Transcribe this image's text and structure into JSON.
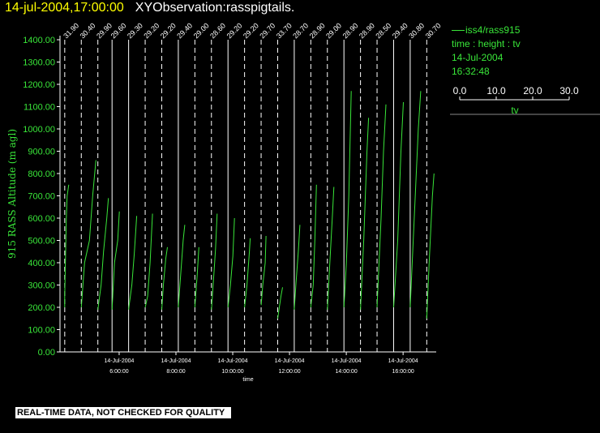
{
  "header": {
    "datetime": "14-jul-2004,17:00:00",
    "title": "XYObservation:rasspigtails."
  },
  "legend": {
    "series": "iss4/rass915",
    "axes": "time : height : tv",
    "date": "14-Jul-2004",
    "time": "16:32:48",
    "scale_ticks": [
      "0.0",
      "10.0",
      "20.0",
      "30.0"
    ],
    "scale_label": "tv"
  },
  "footer": "REAL-TIME DATA, NOT CHECKED FOR QUALITY",
  "colors": {
    "background": "#000000",
    "trace": "#39e639",
    "axis": "#ffffff",
    "title": "#ffff00"
  },
  "chart_data": {
    "type": "line",
    "title": "XYObservation:rasspigtails.",
    "xlabel": "time",
    "ylabel": "915 RASS Altitude (m agl)",
    "ylim": [
      0,
      1400
    ],
    "yticks": [
      "0.00",
      "100.00",
      "200.00",
      "300.00",
      "400.00",
      "500.00",
      "600.00",
      "700.00",
      "800.00",
      "900.00",
      "1000.00",
      "1100.00",
      "1200.00",
      "1300.00",
      "1400.00"
    ],
    "xlim": [
      "04:05",
      "17:00"
    ],
    "xticks": [
      {
        "time": "06:00",
        "date": "14-Jul-2004",
        "label": "6:00:00"
      },
      {
        "time": "08:00",
        "date": "14-Jul-2004",
        "label": "8:00:00"
      },
      {
        "time": "10:00",
        "date": "14-Jul-2004",
        "label": "10:00:00"
      },
      {
        "time": "12:00",
        "date": "14-Jul-2004",
        "label": "12:00:00"
      },
      {
        "time": "14:00",
        "date": "14-Jul-2004",
        "label": "14:00:00"
      },
      {
        "time": "16:00",
        "date": "14-Jul-2004",
        "label": "16:00:00"
      }
    ],
    "grid": "vertical dashed lines at each profile time",
    "profiles": [
      {
        "time": "04:05",
        "label": "31.90",
        "tv": [
          [
            0,
            200
          ],
          [
            0,
            250
          ],
          [
            2,
            600
          ],
          [
            3,
            700
          ],
          [
            5,
            750
          ]
        ]
      },
      {
        "time": "04:40",
        "label": "30.40",
        "tv": [
          [
            0,
            200
          ],
          [
            4,
            400
          ],
          [
            10,
            500
          ],
          [
            14,
            700
          ],
          [
            18,
            860
          ]
        ]
      },
      {
        "time": "05:15",
        "label": "29.90",
        "tv": [
          [
            0,
            190
          ],
          [
            4,
            300
          ],
          [
            7,
            450
          ],
          [
            11,
            600
          ],
          [
            13,
            690
          ]
        ]
      },
      {
        "time": "05:45",
        "label": "29.60",
        "tv": [
          [
            0,
            190
          ],
          [
            3,
            400
          ],
          [
            7,
            500
          ],
          [
            9,
            630
          ]
        ]
      },
      {
        "time": "06:20",
        "label": "29.30",
        "tv": [
          [
            0,
            190
          ],
          [
            4,
            300
          ],
          [
            7,
            440
          ],
          [
            10,
            610
          ]
        ]
      },
      {
        "time": "06:55",
        "label": "29.20",
        "tv": [
          [
            0,
            200
          ],
          [
            3,
            250
          ],
          [
            6,
            400
          ],
          [
            9,
            620
          ]
        ]
      },
      {
        "time": "07:30",
        "label": "29.20",
        "tv": [
          [
            0,
            190
          ],
          [
            2,
            300
          ],
          [
            5,
            420
          ],
          [
            7,
            470
          ]
        ]
      },
      {
        "time": "08:05",
        "label": "29.40",
        "tv": [
          [
            0,
            200
          ],
          [
            3,
            350
          ],
          [
            6,
            500
          ],
          [
            8,
            570
          ]
        ]
      },
      {
        "time": "08:40",
        "label": "29.00",
        "tv": [
          [
            0,
            200
          ],
          [
            3,
            350
          ],
          [
            5,
            470
          ]
        ]
      },
      {
        "time": "09:15",
        "label": "28.60",
        "tv": [
          [
            0,
            190
          ],
          [
            3,
            350
          ],
          [
            5,
            460
          ],
          [
            7,
            620
          ]
        ]
      },
      {
        "time": "09:50",
        "label": "29.20",
        "tv": [
          [
            0,
            200
          ],
          [
            3,
            300
          ],
          [
            6,
            430
          ],
          [
            8,
            600
          ]
        ]
      },
      {
        "time": "10:25",
        "label": "29.20",
        "tv": [
          [
            0,
            200
          ],
          [
            3,
            300
          ],
          [
            6,
            450
          ],
          [
            7,
            510
          ]
        ]
      },
      {
        "time": "11:00",
        "label": "29.70",
        "tv": [
          [
            0,
            210
          ],
          [
            2,
            300
          ],
          [
            5,
            400
          ],
          [
            6,
            520
          ]
        ]
      },
      {
        "time": "11:35",
        "label": "33.70",
        "tv": [
          [
            0,
            150
          ],
          [
            4,
            250
          ],
          [
            6,
            290
          ]
        ]
      },
      {
        "time": "12:10",
        "label": "28.70",
        "tv": [
          [
            0,
            190
          ],
          [
            2,
            300
          ],
          [
            5,
            450
          ],
          [
            7,
            570
          ]
        ]
      },
      {
        "time": "12:45",
        "label": "28.90",
        "tv": [
          [
            0,
            200
          ],
          [
            3,
            300
          ],
          [
            5,
            500
          ],
          [
            7,
            750
          ]
        ]
      },
      {
        "time": "13:20",
        "label": "29.00",
        "tv": [
          [
            0,
            190
          ],
          [
            3,
            400
          ],
          [
            6,
            600
          ],
          [
            8,
            740
          ]
        ]
      },
      {
        "time": "13:55",
        "label": "28.90",
        "tv": [
          [
            0,
            200
          ],
          [
            3,
            400
          ],
          [
            6,
            700
          ],
          [
            9,
            1170
          ]
        ]
      },
      {
        "time": "14:30",
        "label": "28.90",
        "tv": [
          [
            0,
            190
          ],
          [
            4,
            500
          ],
          [
            8,
            900
          ],
          [
            10,
            1050
          ]
        ]
      },
      {
        "time": "15:05",
        "label": "28.50",
        "tv": [
          [
            0,
            200
          ],
          [
            5,
            600
          ],
          [
            8,
            900
          ],
          [
            11,
            1110
          ]
        ]
      },
      {
        "time": "15:40",
        "label": "29.40",
        "tv": [
          [
            0,
            200
          ],
          [
            5,
            500
          ],
          [
            9,
            900
          ],
          [
            12,
            1120
          ]
        ]
      },
      {
        "time": "16:15",
        "label": "30.80",
        "tv": [
          [
            0,
            200
          ],
          [
            5,
            600
          ],
          [
            10,
            1000
          ],
          [
            13,
            1170
          ]
        ]
      },
      {
        "time": "16:50",
        "label": "30.70",
        "tv": [
          [
            0,
            150
          ],
          [
            3,
            400
          ],
          [
            7,
            700
          ],
          [
            9,
            800
          ]
        ]
      }
    ]
  }
}
